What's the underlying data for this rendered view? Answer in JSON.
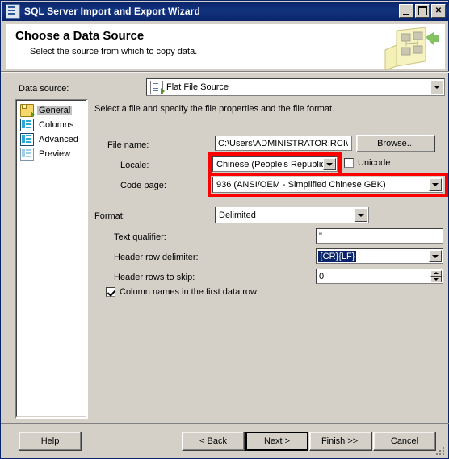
{
  "window": {
    "title": "SQL Server Import and Export Wizard",
    "icon": "wizard-window-icon",
    "buttons": {
      "minimize": "_",
      "maximize": "□",
      "close": "✕"
    }
  },
  "banner": {
    "title": "Choose a Data Source",
    "subtitle": "Select the source from which to copy data.",
    "art": "data-flow-panel-icon"
  },
  "datasource": {
    "label": "Data source:",
    "value": "Flat File Source",
    "icon": "flat-file-source-icon"
  },
  "nav": {
    "items": [
      {
        "label": "General",
        "icon": "folder-icon",
        "selected": true
      },
      {
        "label": "Columns",
        "icon": "grid-icon",
        "selected": false
      },
      {
        "label": "Advanced",
        "icon": "grid-icon",
        "selected": false
      },
      {
        "label": "Preview",
        "icon": "grid-light-icon",
        "selected": false
      }
    ]
  },
  "general": {
    "instruction": "Select a file and specify the file properties and the file format.",
    "file_name_label": "File name:",
    "file_name_value": "C:\\Users\\ADMINISTRATOR.RCI\\",
    "browse_label": "Browse...",
    "locale_label": "Locale:",
    "locale_value": "Chinese (People's Republic",
    "unicode_label": "Unicode",
    "unicode_checked": false,
    "code_page_label": "Code page:",
    "code_page_value": "936   (ANSI/OEM - Simplified Chinese GBK)"
  },
  "format": {
    "label": "Format:",
    "value": "Delimited",
    "text_qualifier_label": "Text qualifier:",
    "text_qualifier_value": "\"",
    "header_row_delimiter_label": "Header row delimiter:",
    "header_row_delimiter_value": "{CR}{LF}",
    "header_rows_to_skip_label": "Header rows to skip:",
    "header_rows_to_skip_value": "0",
    "column_names_label": "Column names in the first data row",
    "column_names_checked": true
  },
  "footer": {
    "help": "Help",
    "back": "< Back",
    "next": "Next >",
    "finish": "Finish >>|",
    "cancel": "Cancel"
  },
  "highlights": {
    "color": "#ff0000",
    "regions": [
      "locale-dropdown",
      "code-page-dropdown"
    ]
  }
}
